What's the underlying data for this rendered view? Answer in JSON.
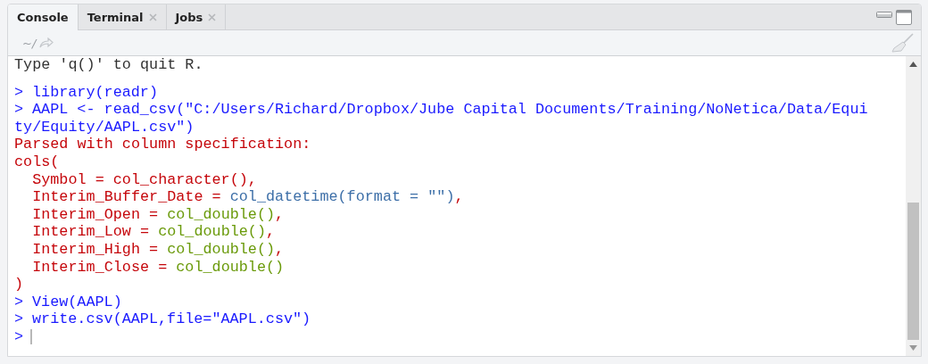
{
  "tabs": [
    {
      "label": "Console",
      "selected": true,
      "closable": false
    },
    {
      "label": "Terminal",
      "selected": false,
      "closable": true
    },
    {
      "label": "Jobs",
      "selected": false,
      "closable": true
    }
  ],
  "toolbar": {
    "path": "~/"
  },
  "console": {
    "lines": [
      {
        "segments": [
          {
            "text": "Type 'q()' to quit R.",
            "kind": "output"
          }
        ]
      },
      {
        "prompt": ">",
        "segments": [
          {
            "text": "library(readr)",
            "kind": "input"
          }
        ]
      },
      {
        "prompt": ">",
        "segments": [
          {
            "text": "AAPL <- read_csv(\"C:/Users/Richard/Dropbox/Jube Capital Documents/Training/NoNetica/Data/Equi",
            "kind": "input"
          }
        ]
      },
      {
        "segments": [
          {
            "text": "ty/Equity/AAPL.csv\")",
            "kind": "input"
          }
        ]
      },
      {
        "segments": [
          {
            "text": "Parsed with column specification:",
            "kind": "message"
          }
        ]
      },
      {
        "segments": [
          {
            "text": "cols(",
            "kind": "message"
          }
        ]
      },
      {
        "segments": [
          {
            "text": "  Symbol = col_character(),",
            "kind": "message"
          }
        ]
      },
      {
        "segments": [
          {
            "text": "  Interim_Buffer_Date = ",
            "kind": "message"
          },
          {
            "text": "col_datetime(format = \"\")",
            "kind": "datetime"
          },
          {
            "text": ",",
            "kind": "message"
          }
        ]
      },
      {
        "segments": [
          {
            "text": "  Interim_Open = ",
            "kind": "message"
          },
          {
            "text": "col_double()",
            "kind": "double"
          },
          {
            "text": ",",
            "kind": "message"
          }
        ]
      },
      {
        "segments": [
          {
            "text": "  Interim_Low = ",
            "kind": "message"
          },
          {
            "text": "col_double()",
            "kind": "double"
          },
          {
            "text": ",",
            "kind": "message"
          }
        ]
      },
      {
        "segments": [
          {
            "text": "  Interim_High = ",
            "kind": "message"
          },
          {
            "text": "col_double()",
            "kind": "double"
          },
          {
            "text": ",",
            "kind": "message"
          }
        ]
      },
      {
        "segments": [
          {
            "text": "  Interim_Close = ",
            "kind": "message"
          },
          {
            "text": "col_double()",
            "kind": "double"
          }
        ]
      },
      {
        "segments": [
          {
            "text": ")",
            "kind": "message"
          }
        ]
      },
      {
        "prompt": ">",
        "segments": [
          {
            "text": "View(AAPL)",
            "kind": "input"
          }
        ]
      },
      {
        "prompt": ">",
        "segments": [
          {
            "text": "write.csv(AAPL,file=\"AAPL.csv\")",
            "kind": "input"
          }
        ]
      }
    ],
    "input_prompt": ">"
  }
}
